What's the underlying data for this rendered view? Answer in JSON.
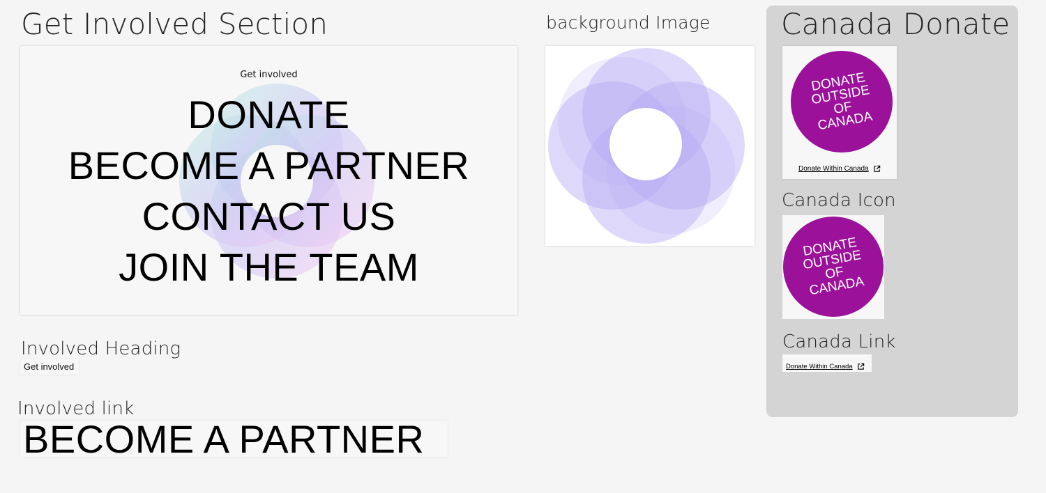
{
  "get_involved_section": {
    "title": "Get Involved Section",
    "eyebrow": "Get involved",
    "links": [
      "DONATE",
      "BECOME A PARTNER",
      "CONTACT US",
      "JOIN THE TEAM"
    ]
  },
  "background_image": {
    "label": "background Image"
  },
  "canada_donate": {
    "title": "Canada Donate",
    "badge_lines": [
      "DONATE",
      "OUTSIDE",
      "OF",
      "CANADA"
    ],
    "link_text": "Donate Within Canada",
    "icon_label": "Canada Icon",
    "link_label": "Canada Link"
  },
  "involved_heading": {
    "label": "Involved Heading",
    "text": "Get involved"
  },
  "involved_link": {
    "label": "Involved link",
    "text": "BECOME A PARTNER"
  },
  "colors": {
    "badge": "#9b119a",
    "ring": "#b5aaf5",
    "panel": "#d4d4d4"
  },
  "icons": {
    "external_link": "external-link-icon"
  }
}
